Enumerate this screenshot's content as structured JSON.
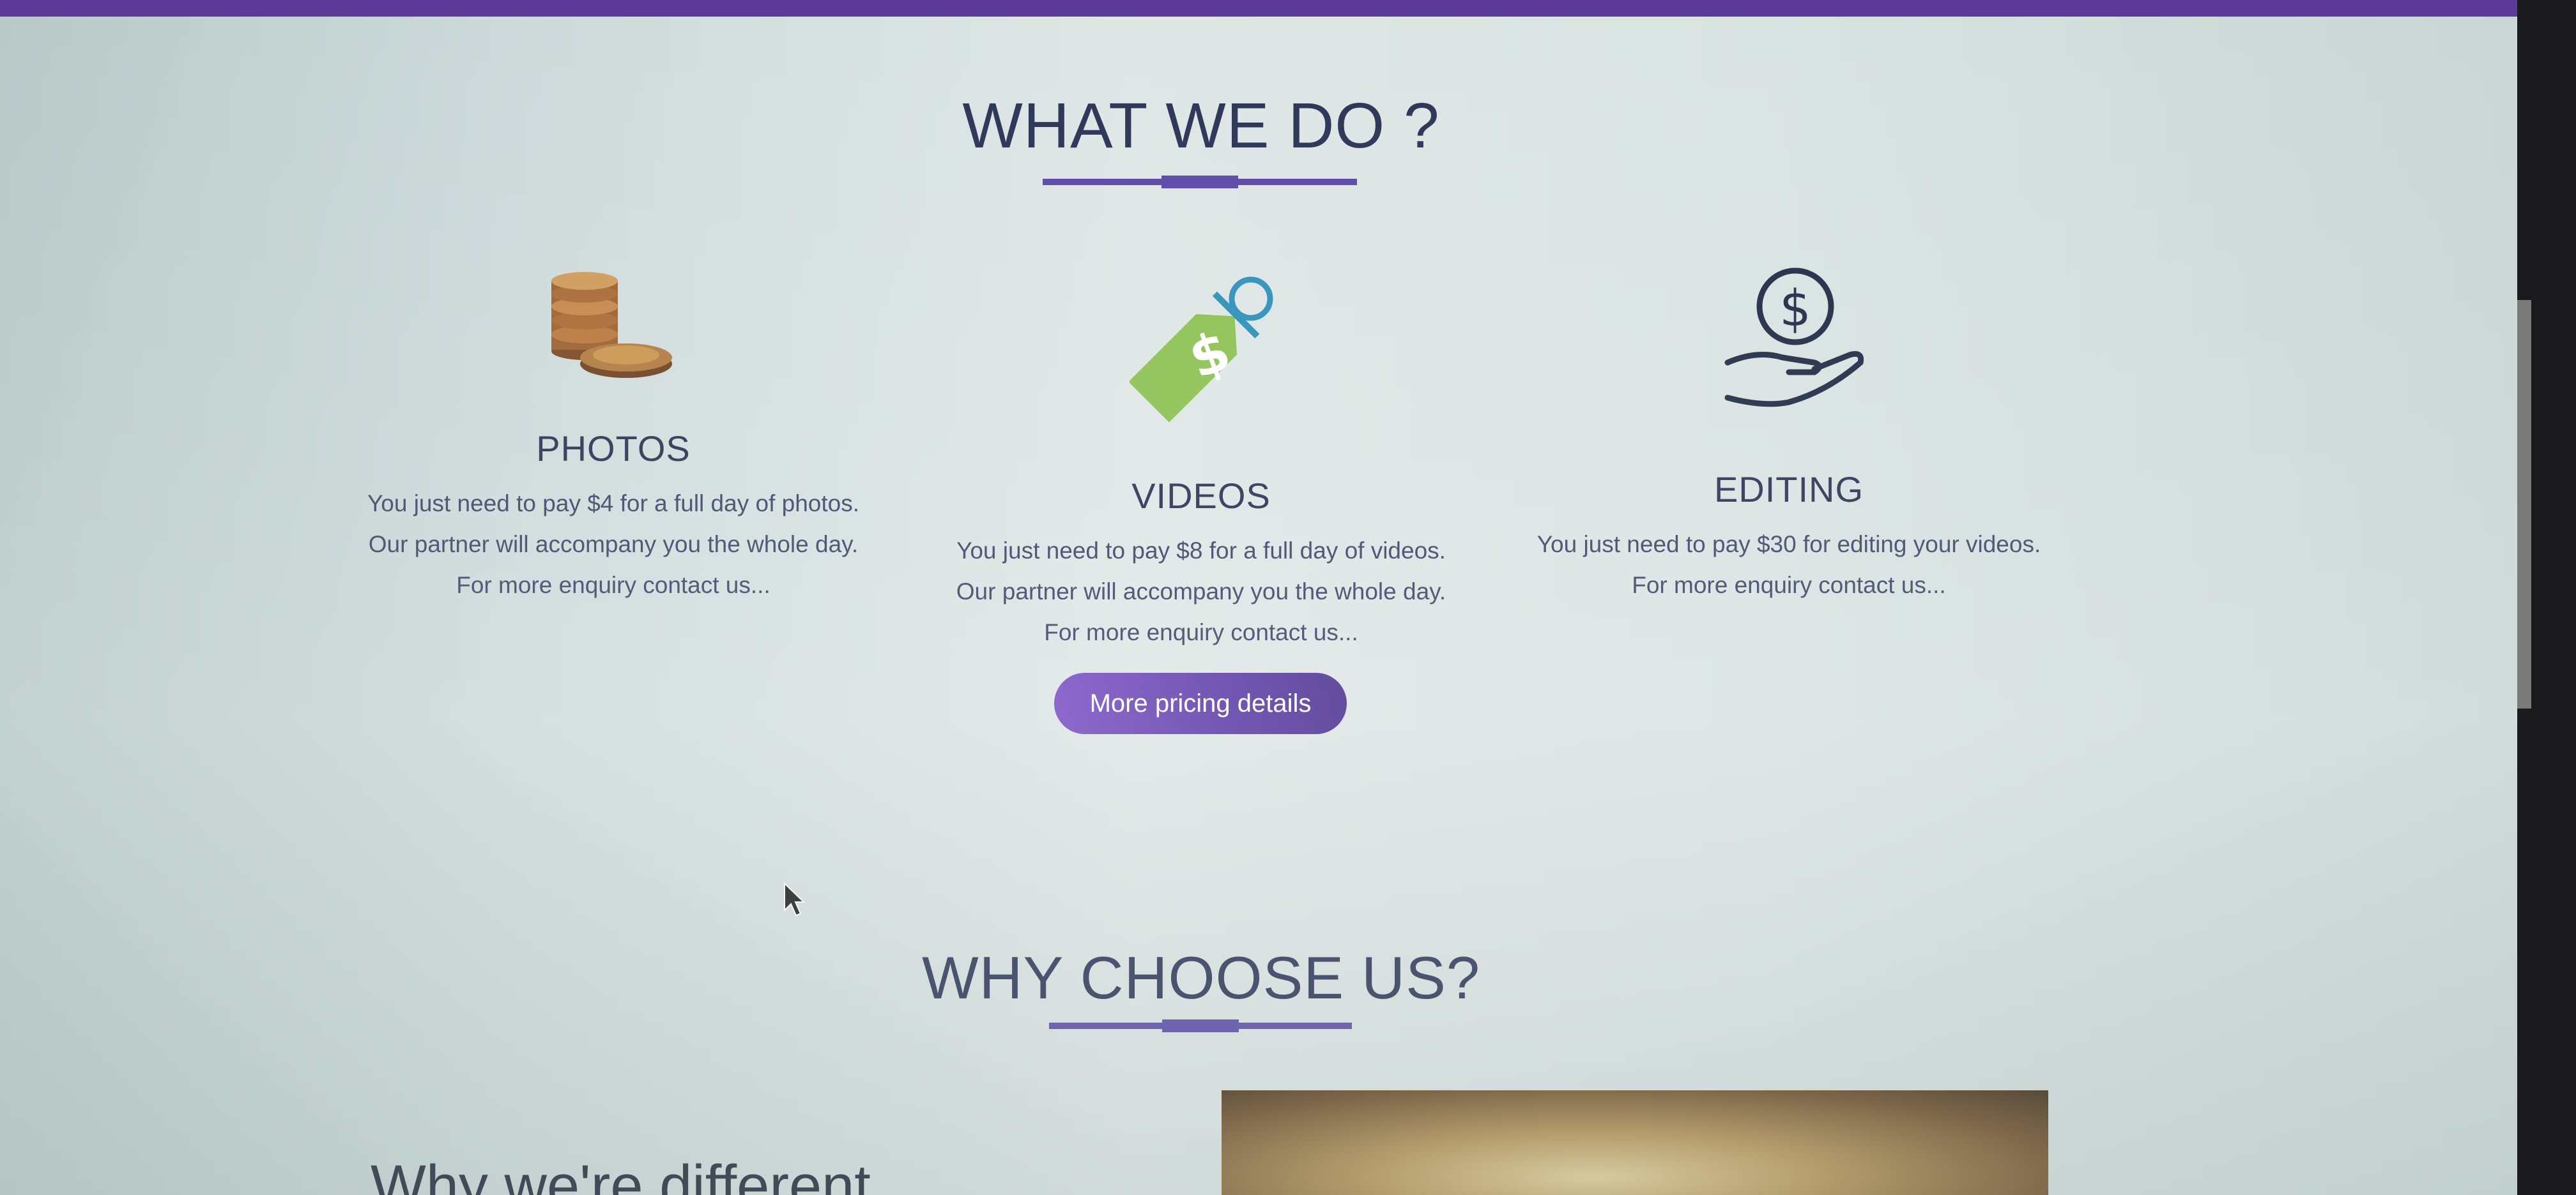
{
  "sections": {
    "what_we_do": {
      "title": "WHAT WE DO ?"
    },
    "why_choose_us": {
      "title": "WHY CHOOSE US?",
      "subheading": "Why we're different"
    }
  },
  "services": [
    {
      "icon": "coins-icon",
      "title": "PHOTOS",
      "lines": [
        "You just need to pay $4 for a full day of photos.",
        "Our partner will accompany you the whole day.",
        "For more enquiry contact us..."
      ]
    },
    {
      "icon": "price-tag-icon",
      "title": "VIDEOS",
      "lines": [
        "You just need to pay $8 for a full day of videos.",
        "Our partner will accompany you the whole day.",
        "For more enquiry contact us..."
      ]
    },
    {
      "icon": "hand-dollar-icon",
      "title": "EDITING",
      "lines": [
        "You just need to pay $30 for editing your videos.",
        "For more enquiry contact us..."
      ]
    }
  ],
  "button": {
    "pricing_label": "More pricing details"
  },
  "colors": {
    "accent": "#5b48a8",
    "heading": "#2b3456",
    "tag_green": "#8cc152",
    "tag_blue": "#2d8fb8"
  }
}
